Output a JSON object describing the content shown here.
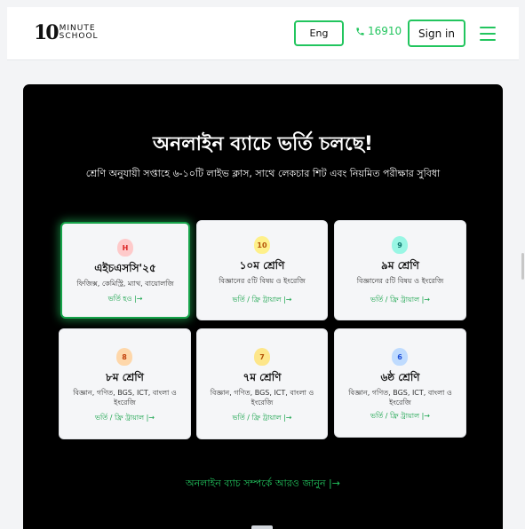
{
  "header": {
    "logo": {
      "number": "10",
      "line1": "MINUTE",
      "line2": "SCHOOL"
    },
    "language_button": "Eng",
    "phone": "16910",
    "signin_button": "Sign in"
  },
  "hero": {
    "title": "অনলাইন ব্যাচে ভর্তি চলছে!",
    "subtitle": "শ্রেণি অনুযায়ী সপ্তাহে ৬-১০টি লাইভ ক্লাস, সাথে লেকচার শিট এবং নিয়মিত পরীক্ষার সুবিধা",
    "more_link": "অনলাইন ব্যাচ সম্পর্কে আরও জানুন |→"
  },
  "cards": [
    {
      "badge": "H",
      "badge_color": "#fecaca",
      "badge_text_color": "#dc2626",
      "title": "এইচএসসি'২৫",
      "desc": "ফিজিক্স, কেমিস্ট্রি, ম্যাথ, বায়োলজি",
      "link": "ভর্তি হও |→",
      "active": true
    },
    {
      "badge": "10",
      "badge_color": "#fef08a",
      "badge_text_color": "#b45309",
      "title": "১০ম শ্রেণি",
      "desc": "বিজ্ঞানের ৫টি বিষয় ও ইংরেজি",
      "link": "ভর্তি / ফ্রি ট্রায়াল |→",
      "active": false
    },
    {
      "badge": "9",
      "badge_color": "#99f6e4",
      "badge_text_color": "#0f766e",
      "title": "৯ম শ্রেণি",
      "desc": "বিজ্ঞানের ৫টি বিষয় ও ইংরেজি",
      "link": "ভর্তি / ফ্রি ট্রায়াল |→",
      "active": false
    },
    {
      "badge": "8",
      "badge_color": "#fed7aa",
      "badge_text_color": "#c2410c",
      "title": "৮ম শ্রেণি",
      "desc": "বিজ্ঞান, গণিত, BGS, ICT, বাংলা ও ইংরেজি",
      "link": "ভর্তি / ফ্রি ট্রায়াল |→",
      "active": false
    },
    {
      "badge": "7",
      "badge_color": "#fde68a",
      "badge_text_color": "#b45309",
      "title": "৭ম শ্রেণি",
      "desc": "বিজ্ঞান, গণিত, BGS, ICT, বাংলা ও ইংরেজি",
      "link": "ভর্তি / ফ্রি ট্রায়াল |→",
      "active": false
    },
    {
      "badge": "6",
      "badge_color": "#bfdbfe",
      "badge_text_color": "#1d4ed8",
      "title": "৬ষ্ঠ শ্রেণি",
      "desc": "বিজ্ঞান, গণিত, BGS, ICT, বাংলা ও ইংরেজি",
      "link": "ভর্তি / ফ্রি ট্রায়াল |→",
      "active": false
    }
  ],
  "colors": {
    "accent": "#22c55e",
    "hero_bg": "#000000",
    "card_bg": "#f5f6f8"
  }
}
